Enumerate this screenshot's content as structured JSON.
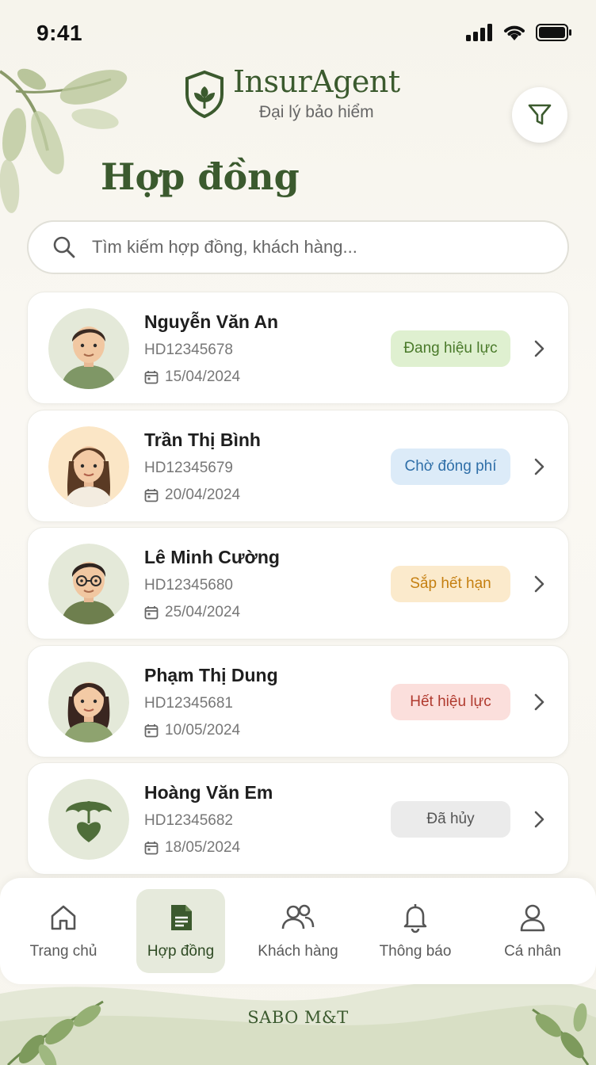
{
  "status_bar": {
    "time": "9:41"
  },
  "brand": {
    "name": "InsurAgent",
    "subtitle": "Đại lý bảo hiểm"
  },
  "page": {
    "title": "Hợp đồng"
  },
  "search": {
    "placeholder": "Tìm kiếm hợp đồng, khách hàng..."
  },
  "contracts": [
    {
      "name": "Nguyễn Văn An",
      "code": "HD12345678",
      "date": "15/04/2024",
      "status": "Đang hiệu lực",
      "status_bg": "#dff0d0",
      "status_color": "#4a7a2a",
      "avatar": "man-avatar"
    },
    {
      "name": "Trần Thị Bình",
      "code": "HD12345679",
      "date": "20/04/2024",
      "status": "Chờ đóng phí",
      "status_bg": "#dcebf8",
      "status_color": "#2f6fa8",
      "avatar": "woman-avatar"
    },
    {
      "name": "Lê Minh Cường",
      "code": "HD12345680",
      "date": "25/04/2024",
      "status": "Sắp hết hạn",
      "status_bg": "#fbeacc",
      "status_color": "#c57f10",
      "avatar": "man-glasses-avatar"
    },
    {
      "name": "Phạm Thị Dung",
      "code": "HD12345681",
      "date": "10/05/2024",
      "status": "Hết hiệu lực",
      "status_bg": "#fbdfdc",
      "status_color": "#b03a2e",
      "avatar": "woman-avatar"
    },
    {
      "name": "Hoàng Văn Em",
      "code": "HD12345682",
      "date": "18/05/2024",
      "status": "Đã hủy",
      "status_bg": "#ebebeb",
      "status_color": "#555555",
      "avatar": "umbrella-heart-icon"
    }
  ],
  "nav": {
    "items": [
      {
        "label": "Trang chủ",
        "icon": "home-icon",
        "active": false
      },
      {
        "label": "Hợp đồng",
        "icon": "document-icon",
        "active": true
      },
      {
        "label": "Khách hàng",
        "icon": "users-icon",
        "active": false
      },
      {
        "label": "Thông báo",
        "icon": "bell-icon",
        "active": false
      },
      {
        "label": "Cá nhân",
        "icon": "user-icon",
        "active": false
      }
    ]
  },
  "footer": {
    "text": "SABO M&T"
  },
  "colors": {
    "brand_green": "#3b5a2e",
    "background": "#f8f6ef",
    "active_nav_bg": "#e6eadc"
  }
}
